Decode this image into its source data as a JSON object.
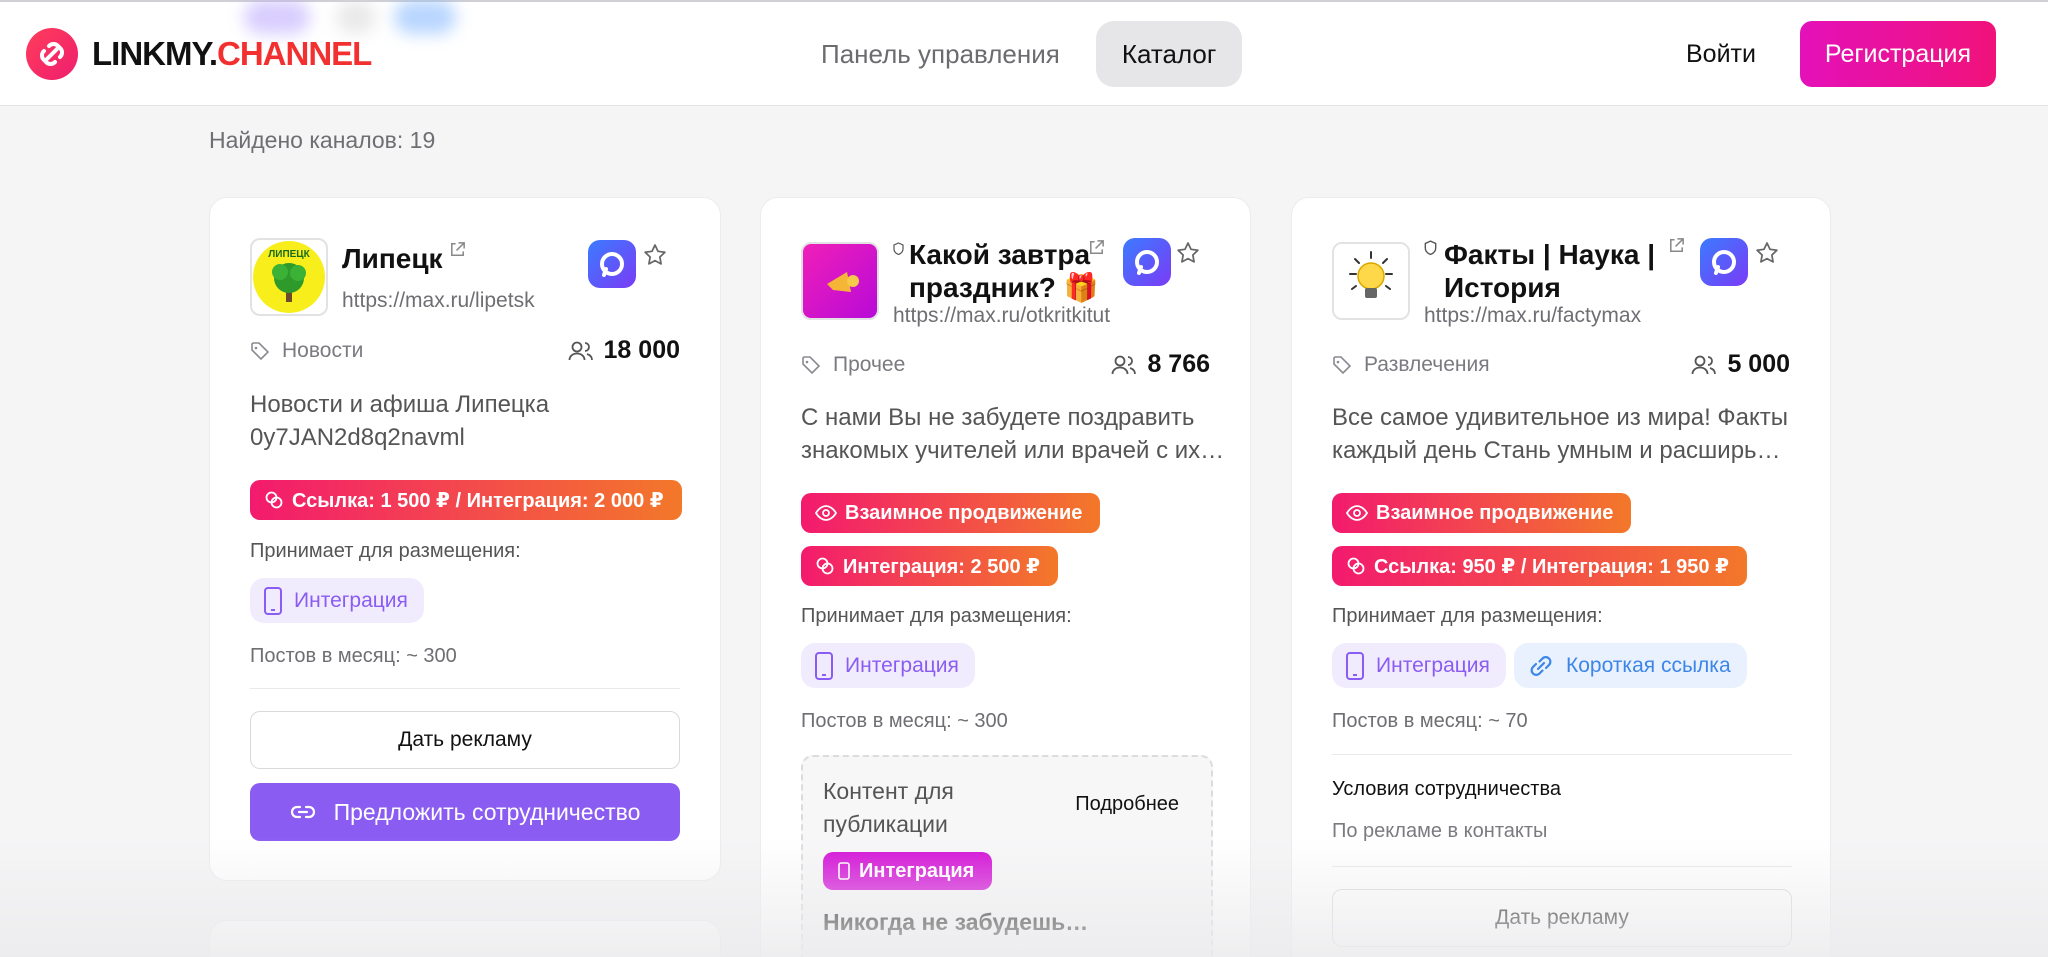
{
  "brand": {
    "logo_dark": "LINKMY.",
    "logo_red": "CHANNEL"
  },
  "nav": {
    "dashboard": "Панель управления",
    "catalog": "Каталог",
    "login": "Войти",
    "register": "Регистрация"
  },
  "found_label": "Найдено каналов: 19",
  "cards": [
    {
      "title": "Липецк",
      "url": "https://max.ru/lipetsk",
      "avatar_text": "ЛИПЕЦК",
      "category": "Новости",
      "subscribers": "18 000",
      "description_line1": "Новости и афиша Липецка",
      "description_line2": "0y7JAN2d8q2navml",
      "pill_price": "Ссылка: 1 500 ₽ / Интеграция: 2 000 ₽",
      "accepts_label": "Принимает для размещения:",
      "chip_integration": "Интеграция",
      "posts": "Постов в месяц: ~ 300",
      "btn_ad": "Дать рекламу",
      "btn_collab": "Предложить сотрудничество"
    },
    {
      "title_line1": "Какой завтра",
      "title_line2": "праздник? 🎁",
      "url": "https://max.ru/otkritkitut",
      "category": "Прочее",
      "subscribers": "8 766",
      "description_line1": "С нами Вы не забудете поздравить",
      "description_line2": "знакомых учителей или врачей с их…",
      "pill_mutual": "Взаимное продвижение",
      "pill_price": "Интеграция: 2 500 ₽",
      "accepts_label": "Принимает для размещения:",
      "chip_integration": "Интеграция",
      "posts": "Постов в месяц: ~ 300",
      "content_title_line1": "Контент для",
      "content_title_line2": "публикации",
      "content_more": "Подробнее",
      "content_tag": "Интеграция",
      "content_snippet": "Никогда не забудешь…"
    },
    {
      "title_line1": "Факты | Наука |",
      "title_line2": "История",
      "url": "https://max.ru/factymax",
      "category": "Развлечения",
      "subscribers": "5 000",
      "description_line1": "Все самое удивительное из мира! Факты",
      "description_line2": "каждый день Стань умным и расширь…",
      "pill_mutual": "Взаимное продвижение",
      "pill_price": "Ссылка: 950 ₽ / Интеграция: 1 950 ₽",
      "accepts_label": "Принимает для размещения:",
      "chip_integration": "Интеграция",
      "chip_link": "Короткая ссылка",
      "posts": "Постов в месяц: ~ 70",
      "terms_title": "Условия сотрудничества",
      "terms_text": "По рекламе в контакты",
      "btn_ad": "Дать рекламу"
    }
  ],
  "colors": {
    "accent_purple": "#8a5cf2",
    "brand_red": "#f2302f",
    "register_gradient_start": "#e411b9",
    "pill_gradient_start": "#f31a6e",
    "pill_gradient_end": "#f3782a"
  }
}
